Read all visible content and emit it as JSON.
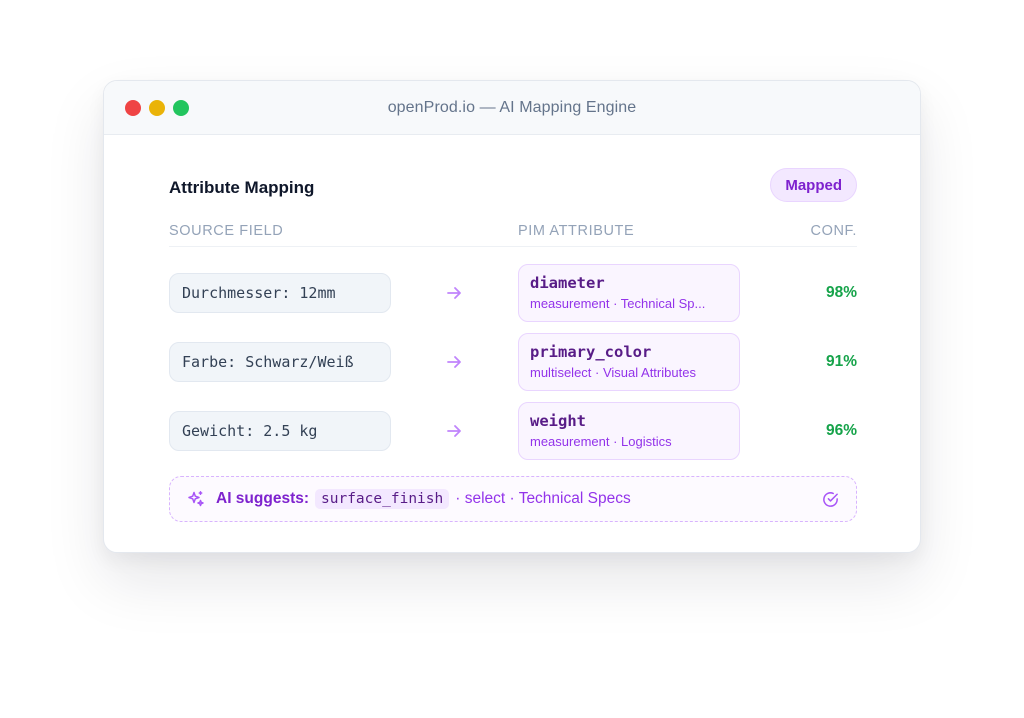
{
  "window": {
    "title": "openProd.io — AI Mapping Engine"
  },
  "panel": {
    "title": "Attribute Mapping",
    "status_badge": "Mapped",
    "columns": {
      "source": "SOURCE FIELD",
      "pim": "PIM ATTRIBUTE",
      "conf": "CONF."
    }
  },
  "rows": [
    {
      "source": "Durchmesser: 12mm",
      "attribute": "diameter",
      "meta": "measurement · Technical Sp...",
      "confidence": "98%"
    },
    {
      "source": "Farbe: Schwarz/Weiß",
      "attribute": "primary_color",
      "meta": "multiselect · Visual Attributes",
      "confidence": "91%"
    },
    {
      "source": "Gewicht: 2.5 kg",
      "attribute": "weight",
      "meta": "measurement · Logistics",
      "confidence": "96%"
    }
  ],
  "suggestion": {
    "label": "AI suggests:",
    "attribute": "surface_finish",
    "meta": "· select · Technical Specs"
  },
  "icons": {
    "row_arrow": "arrow-right-icon",
    "suggestion": "sparkles-icon",
    "accept": "circle-check-icon"
  },
  "colors": {
    "accent": "#7e22ce",
    "confidence": "#16a34a",
    "close_dot": "#ef4444",
    "minimize_dot": "#eab308",
    "maximize_dot": "#22c55e"
  }
}
